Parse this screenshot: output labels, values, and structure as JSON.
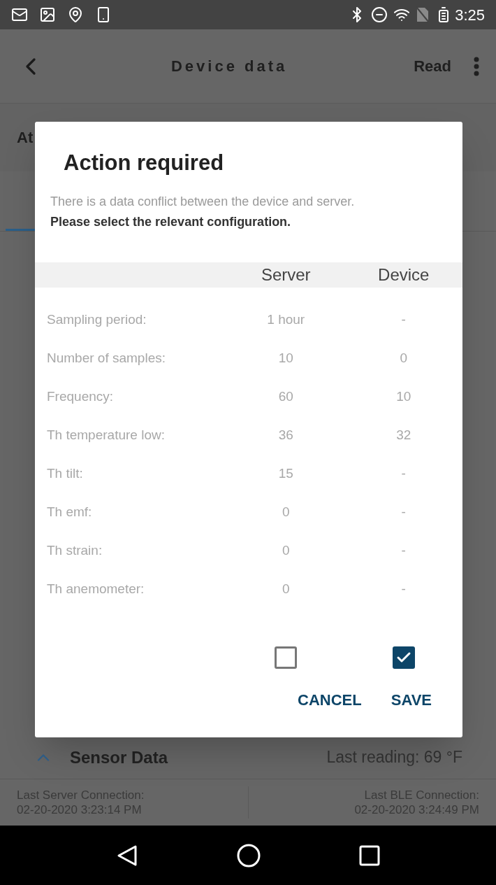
{
  "status_bar": {
    "time": "3:25"
  },
  "toolbar": {
    "title": "Device data",
    "action": "Read"
  },
  "section": {
    "title": "At"
  },
  "dialog": {
    "title": "Action required",
    "message": "There is a data conflict between the device and server.",
    "instruction": "Please select the relevant configuration.",
    "columns": [
      {
        "label": "Server",
        "checked": false
      },
      {
        "label": "Device",
        "checked": true
      }
    ],
    "rows": [
      {
        "label": "Sampling period:",
        "server": "1 hour",
        "device": "-"
      },
      {
        "label": "Number of samples:",
        "server": "10",
        "device": "0"
      },
      {
        "label": "Frequency:",
        "server": "60",
        "device": "10"
      },
      {
        "label": "Th temperature low:",
        "server": "36",
        "device": "32"
      },
      {
        "label": "Th tilt:",
        "server": "15",
        "device": "-"
      },
      {
        "label": "Th emf:",
        "server": "0",
        "device": "-"
      },
      {
        "label": "Th strain:",
        "server": "0",
        "device": "-"
      },
      {
        "label": "Th anemometer:",
        "server": "0",
        "device": "-"
      }
    ],
    "buttons": [
      "CANCEL",
      "SAVE"
    ]
  },
  "sensor": {
    "title": "Sensor Data",
    "expanded": true,
    "reading": "Last reading: 69 °F"
  },
  "footer": {
    "server_label": "Last Server Connection:",
    "server_time": "02-20-2020 3:23:14 PM",
    "ble_label": "Last BLE Connection:",
    "ble_time": "02-20-2020 3:24:49 PM"
  }
}
